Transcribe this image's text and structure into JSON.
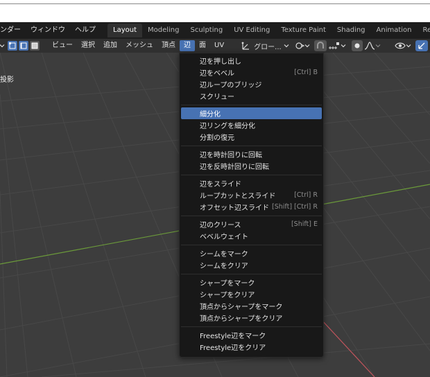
{
  "menubar": {
    "items": [
      "ンダー",
      "ウィンドウ",
      "ヘルプ"
    ],
    "tabs": [
      {
        "label": "Layout",
        "active": true
      },
      {
        "label": "Modeling",
        "active": false
      },
      {
        "label": "Sculpting",
        "active": false
      },
      {
        "label": "UV Editing",
        "active": false
      },
      {
        "label": "Texture Paint",
        "active": false
      },
      {
        "label": "Shading",
        "active": false
      },
      {
        "label": "Animation",
        "active": false
      },
      {
        "label": "Renderin",
        "active": false
      }
    ]
  },
  "header": {
    "menus": [
      "ビュー",
      "選択",
      "追加",
      "メッシュ",
      "頂点",
      "辺",
      "面",
      "UV"
    ],
    "active_menu": "辺",
    "transform_orientation": "グロー...",
    "icons": [
      "dropdown-chevron-icon",
      "vertex-select-icon",
      "edge-select-icon",
      "face-select-icon",
      "transform-orientation-icon",
      "pivot-icon",
      "snap-icon",
      "snap-increment-icon",
      "proportional-editing-icon",
      "falloff-icon",
      "visibility-icon",
      "gizmo-icon"
    ]
  },
  "viewport": {
    "label": "投影",
    "grid_color": "#4a4a4a",
    "x_axis_color": "#c0545c",
    "y_axis_color": "#6b9a3a"
  },
  "edge_menu": {
    "items": [
      {
        "label": "辺を押し出し",
        "shortcut": ""
      },
      {
        "label": "辺をベベル",
        "shortcut": "[Ctrl] B"
      },
      {
        "label": "辺ループのブリッジ",
        "shortcut": ""
      },
      {
        "label": "スクリュー",
        "shortcut": ""
      },
      {
        "label": "細分化",
        "shortcut": "",
        "highlighted": true
      },
      {
        "label": "辺リングを細分化",
        "shortcut": ""
      },
      {
        "label": "分割の復元",
        "shortcut": ""
      },
      {
        "label": "辺を時計回りに回転",
        "shortcut": ""
      },
      {
        "label": "辺を反時計回りに回転",
        "shortcut": ""
      },
      {
        "label": "辺をスライド",
        "shortcut": ""
      },
      {
        "label": "ループカットとスライド",
        "shortcut": "[Ctrl] R"
      },
      {
        "label": "オフセット辺スライド",
        "shortcut": "[Shift] [Ctrl] R"
      },
      {
        "label": "辺のクリース",
        "shortcut": "[Shift] E"
      },
      {
        "label": "ベベルウェイト",
        "shortcut": ""
      },
      {
        "label": "シームをマーク",
        "shortcut": ""
      },
      {
        "label": "シームをクリア",
        "shortcut": ""
      },
      {
        "label": "シャープをマーク",
        "shortcut": ""
      },
      {
        "label": "シャープをクリア",
        "shortcut": ""
      },
      {
        "label": "頂点からシャープをマーク",
        "shortcut": ""
      },
      {
        "label": "頂点からシャープをクリア",
        "shortcut": ""
      },
      {
        "label": "Freestyle辺をマーク",
        "shortcut": ""
      },
      {
        "label": "Freestyle辺をクリア",
        "shortcut": ""
      }
    ]
  }
}
